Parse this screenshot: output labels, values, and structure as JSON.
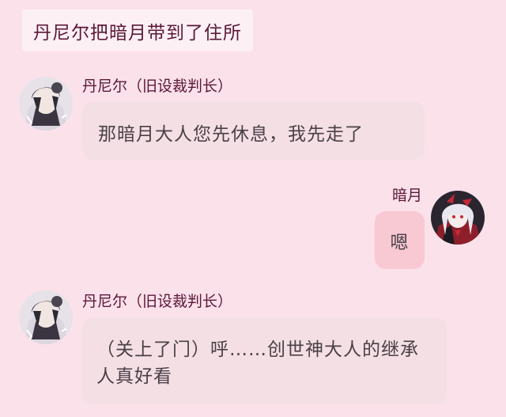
{
  "scene": {
    "narration": "丹尼尔把暗月带到了住所"
  },
  "messages": [
    {
      "side": "left",
      "speaker": "丹尼尔（旧设裁判长）",
      "text": "那暗月大人您先休息，我先走了",
      "avatar_icon": "daniel-avatar"
    },
    {
      "side": "right",
      "speaker": "暗月",
      "text": "嗯",
      "avatar_icon": "anyue-avatar"
    },
    {
      "side": "left",
      "speaker": "丹尼尔（旧设裁判长）",
      "text": "（关上了门）呼……创世神大人的继承人真好看",
      "avatar_icon": "daniel-avatar"
    }
  ],
  "colors": {
    "background": "#fbe1ea",
    "left_bubble": "#f4dfe5",
    "right_bubble": "#f8c8d3",
    "speaker_name": "#5b1838",
    "message_text": "#4a4046"
  }
}
